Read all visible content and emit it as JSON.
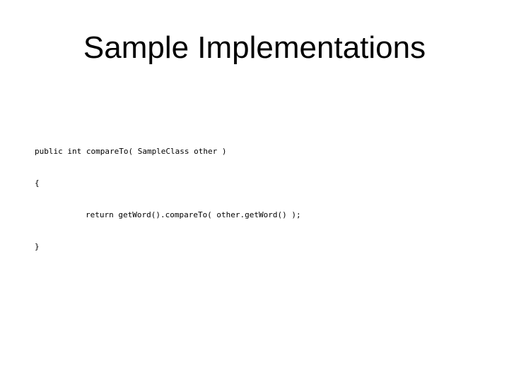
{
  "slide": {
    "title": "Sample Implementations",
    "code": {
      "lines": [
        {
          "indent": false,
          "text": "public int compareTo( SampleClass other )"
        },
        {
          "indent": false,
          "text": "{"
        },
        {
          "indent": true,
          "text": "return getWord().compareTo( other.getWord() );"
        },
        {
          "indent": false,
          "text": "}"
        }
      ]
    }
  }
}
